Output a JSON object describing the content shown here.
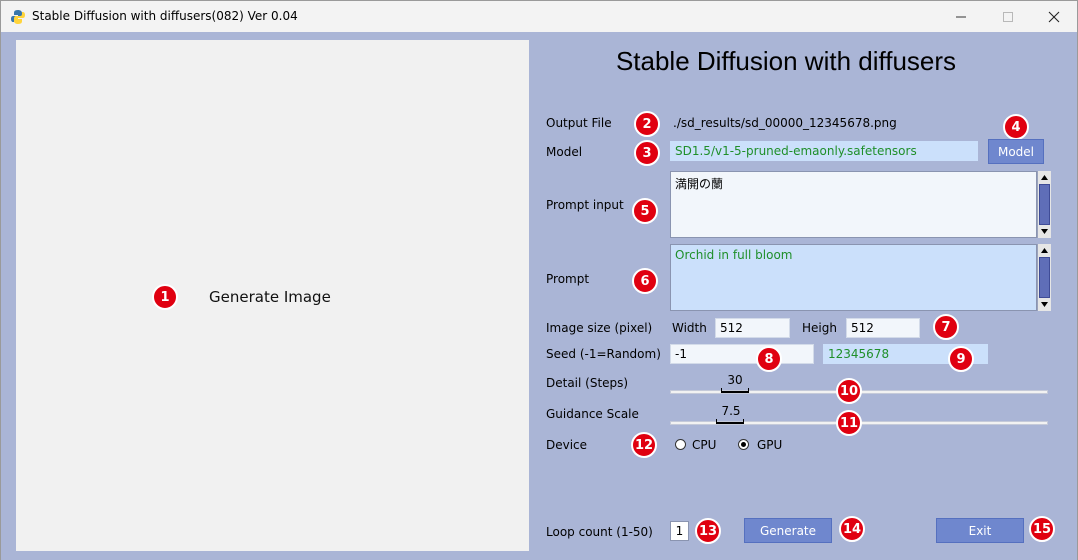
{
  "window": {
    "title": "Stable Diffusion with diffusers(082)  Ver 0.04"
  },
  "image_panel": {
    "placeholder": "Generate Image"
  },
  "form": {
    "heading": "Stable Diffusion with diffusers",
    "output_file_label": "Output File",
    "output_file_value": "./sd_results/sd_00000_12345678.png",
    "model_label": "Model",
    "model_value": "SD1.5/v1-5-pruned-emaonly.safetensors",
    "model_button": "Model",
    "prompt_input_label": "Prompt input",
    "prompt_input_value": "満開の蘭",
    "prompt_label": "Prompt",
    "prompt_value": "Orchid in full bloom",
    "image_size_label": "Image size (pixel)",
    "width_label": "Width",
    "width_value": "512",
    "height_label": "Heigh",
    "height_value": "512",
    "seed_label": "Seed  (-1=Random)",
    "seed_value": "-1",
    "seed_result": "12345678",
    "steps_label": "Detail (Steps)",
    "steps_value": 30,
    "guidance_label": "Guidance Scale",
    "guidance_value": 7.5,
    "device_label": "Device",
    "device_options": [
      "CPU",
      "GPU"
    ],
    "device_selected": "GPU",
    "loop_label": "Loop count (1-50)",
    "loop_value": "1",
    "generate_button": "Generate",
    "exit_button": "Exit"
  },
  "badges": [
    "1",
    "2",
    "3",
    "4",
    "5",
    "6",
    "7",
    "8",
    "9",
    "10",
    "11",
    "12",
    "13",
    "14",
    "15"
  ],
  "colors": {
    "background": "#aab5d6",
    "badge": "#e00010",
    "button": "#6f87ce",
    "green_text": "#1f8f2a",
    "blue_field": "#cbe0fb"
  }
}
